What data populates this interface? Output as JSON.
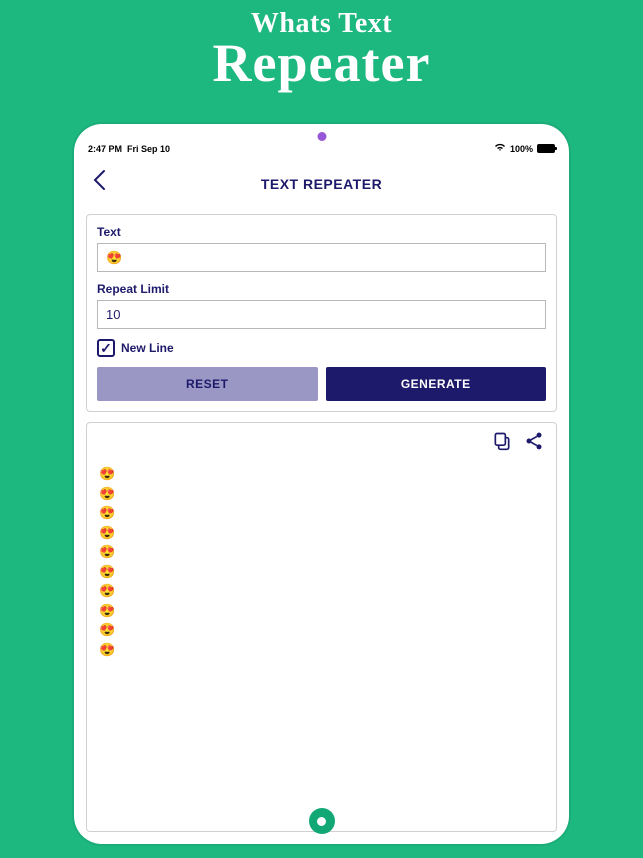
{
  "promo": {
    "line1": "Whats Text",
    "line2": "Repeater"
  },
  "statusBar": {
    "time": "2:47 PM",
    "date": "Fri Sep 10",
    "battery": "100%"
  },
  "header": {
    "title": "TEXT REPEATER"
  },
  "form": {
    "textLabel": "Text",
    "textValue": "😍",
    "repeatLabel": "Repeat Limit",
    "repeatValue": "10",
    "newLineLabel": "New Line",
    "newLineChecked": true,
    "resetLabel": "RESET",
    "generateLabel": "GENERATE"
  },
  "output": {
    "lines": [
      "😍",
      "😍",
      "😍",
      "😍",
      "😍",
      "😍",
      "😍",
      "😍",
      "😍",
      "😍"
    ]
  }
}
